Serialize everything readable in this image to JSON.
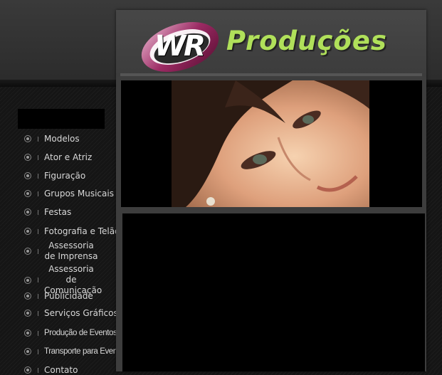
{
  "brand": {
    "logo_text": "WR",
    "name": "Produções",
    "name_color": "#b0e05a",
    "logo_color": "#9b2a63"
  },
  "menu": {
    "items": [
      {
        "label": "Modelos"
      },
      {
        "label": "Ator e Atriz"
      },
      {
        "label": "Figuração"
      },
      {
        "label": "Grupos Musicais"
      },
      {
        "label": "Festas"
      },
      {
        "label": "Fotografia e Telão"
      },
      {
        "label": "Assessoria de Imprensa"
      },
      {
        "label": "Assessoria de Comunicação"
      },
      {
        "label": "Publicidade"
      },
      {
        "label": "Serviços Gráficos"
      },
      {
        "label": "Produção de Eventos"
      },
      {
        "label": "Transporte para Eventos"
      },
      {
        "label": "Contato"
      }
    ]
  },
  "icons": {
    "menu_bullet": "radio-bullet-icon"
  }
}
